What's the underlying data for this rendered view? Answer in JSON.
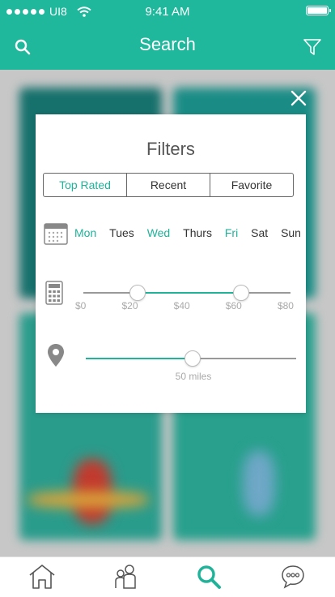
{
  "status_bar": {
    "carrier": "UI8",
    "time": "9:41 AM"
  },
  "header": {
    "title": "Search",
    "icons": [
      "search-icon",
      "filter-icon"
    ]
  },
  "filters": {
    "title": "Filters",
    "sort_tabs": [
      {
        "label": "Top Rated",
        "selected": true
      },
      {
        "label": "Recent",
        "selected": false
      },
      {
        "label": "Favorite",
        "selected": false
      }
    ],
    "days": [
      {
        "label": "Mon",
        "selected": true
      },
      {
        "label": "Tues",
        "selected": false
      },
      {
        "label": "Wed",
        "selected": true
      },
      {
        "label": "Thurs",
        "selected": false
      },
      {
        "label": "Fri",
        "selected": true
      },
      {
        "label": "Sat",
        "selected": false
      },
      {
        "label": "Sun",
        "selected": false
      }
    ],
    "price": {
      "labels": [
        "$0",
        "$20",
        "$40",
        "$60",
        "$80"
      ],
      "range_min": 20,
      "range_max": 60
    },
    "distance": {
      "label": "50 miles",
      "value_fraction": 0.5
    }
  },
  "tabbar": {
    "icons": [
      "home-icon",
      "people-icon",
      "search-icon",
      "chat-icon"
    ],
    "active": "search-icon"
  },
  "colors": {
    "accent": "#1fb89c",
    "text": "#333333",
    "muted": "#aaaaaa"
  }
}
